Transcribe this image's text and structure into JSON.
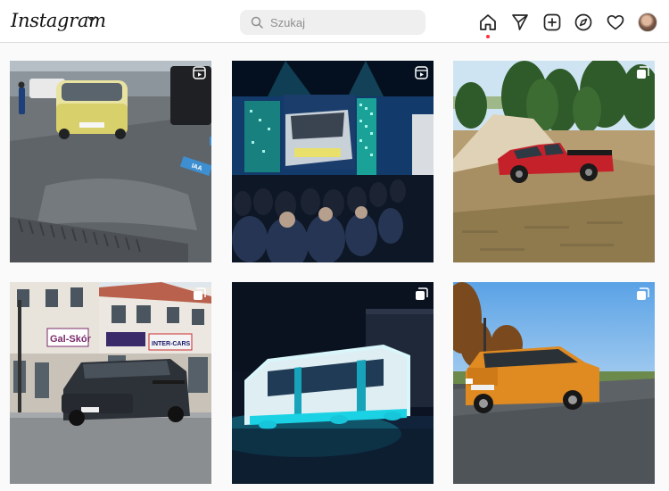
{
  "header": {
    "logo_text": "Instagram",
    "search_placeholder": "Szukaj",
    "nav_icons": [
      "home-icon",
      "direct-icon",
      "new-post-icon",
      "explore-icon",
      "activity-icon",
      "profile-avatar"
    ],
    "notification_dot_color": "#ff3040"
  },
  "grid": {
    "posts": [
      {
        "type": "reel",
        "scene": "Volkswagen ID. Buzz in an IAA exhibition hall",
        "sign": "IAA"
      },
      {
        "type": "reel",
        "scene": "Audience watching a stage with truck presentation and large screens"
      },
      {
        "type": "carousel",
        "scene": "Red pickup truck next to a sand pile by the forest"
      },
      {
        "type": "carousel",
        "scene": "Dark Volkswagen van on a town street",
        "shop_sign": "Gal-Skór",
        "shop_sign_2": "INTER-CARS"
      },
      {
        "type": "carousel",
        "scene": "Electric bus lit in blue at night"
      },
      {
        "type": "carousel",
        "scene": "Orange Suzuki SUV on a road at sunset"
      }
    ]
  }
}
